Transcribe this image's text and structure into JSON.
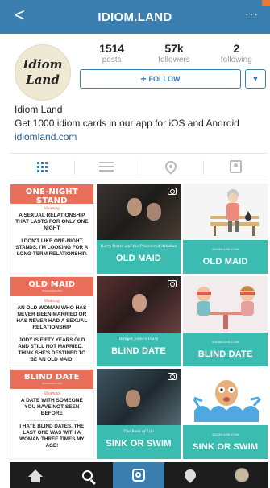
{
  "topbar": {
    "back": "<",
    "title": "IDIOM.LAND",
    "more": "···"
  },
  "avatar": {
    "line1": "Idiom",
    "line2": "Land"
  },
  "stats": [
    {
      "num": "1514",
      "label": "posts"
    },
    {
      "num": "57k",
      "label": "followers"
    },
    {
      "num": "2",
      "label": "following"
    }
  ],
  "follow": {
    "plus": "+",
    "label": "FOLLOW",
    "dropdown": "▼"
  },
  "bio": {
    "name": "Idiom Land",
    "text": "Get 1000 idiom cards in our app for iOS and Android",
    "link": "idiomland.com"
  },
  "colors": {
    "accent": "#3b7fb0",
    "card_header": "#ea6f5a",
    "teal_band": "#3bbcb0"
  },
  "posts": {
    "card1": {
      "title": "ONE-NIGHT STAND",
      "site": "IDIOMLAND.COM",
      "meaning": "Meaning",
      "def": "A SEXUAL RELATIONSHIP THAT LASTS FOR ONLY ONE NIGHT",
      "example": "I DON'T LIKE ONE-NIGHT STANDS. I'M LOOKING FOR A LONG-TERM RELATIONSHIP."
    },
    "photo1": {
      "caption": "Harry Potter and the Prisoner of Azkaban",
      "idiom": "OLD MAID"
    },
    "illus1": {
      "site": "IDIOMLAND.COM",
      "idiom": "OLD MAID"
    },
    "card2": {
      "title": "OLD MAID",
      "site": "IDIOMLAND.COM",
      "meaning": "Meaning",
      "def": "AN OLD WOMAN WHO HAS NEVER BEEN MARRIED OR HAS NEVER HAD A SEXUAL RELATIONSHIP",
      "example": "JODY IS FIFTY YEARS OLD AND STILL NOT MARRIED. I THINK SHE'S DESTINED TO BE AN OLD MAID."
    },
    "photo2": {
      "caption": "Bridget Jones's Diary",
      "idiom": "BLIND DATE"
    },
    "illus2": {
      "site": "IDIOMLAND.COM",
      "idiom": "BLIND DATE"
    },
    "card3": {
      "title": "BLIND DATE",
      "site": "IDIOMLAND.COM",
      "meaning": "Meaning",
      "def": "A DATE WITH SOMEONE YOU HAVE NOT SEEN BEFORE",
      "example": "I HATE BLIND DATES. THE LAST ONE WAS WITH A WOMAN THREE TIMES MY AGE!"
    },
    "photo3": {
      "caption": "The Book of Life",
      "idiom": "SINK OR SWIM"
    },
    "illus3": {
      "site": "IDIOMLAND.COM",
      "idiom": "SINK OR SWIM"
    }
  },
  "bottombar": [
    "home-icon",
    "search-icon",
    "camera-icon",
    "heart-icon",
    "profile-icon"
  ]
}
